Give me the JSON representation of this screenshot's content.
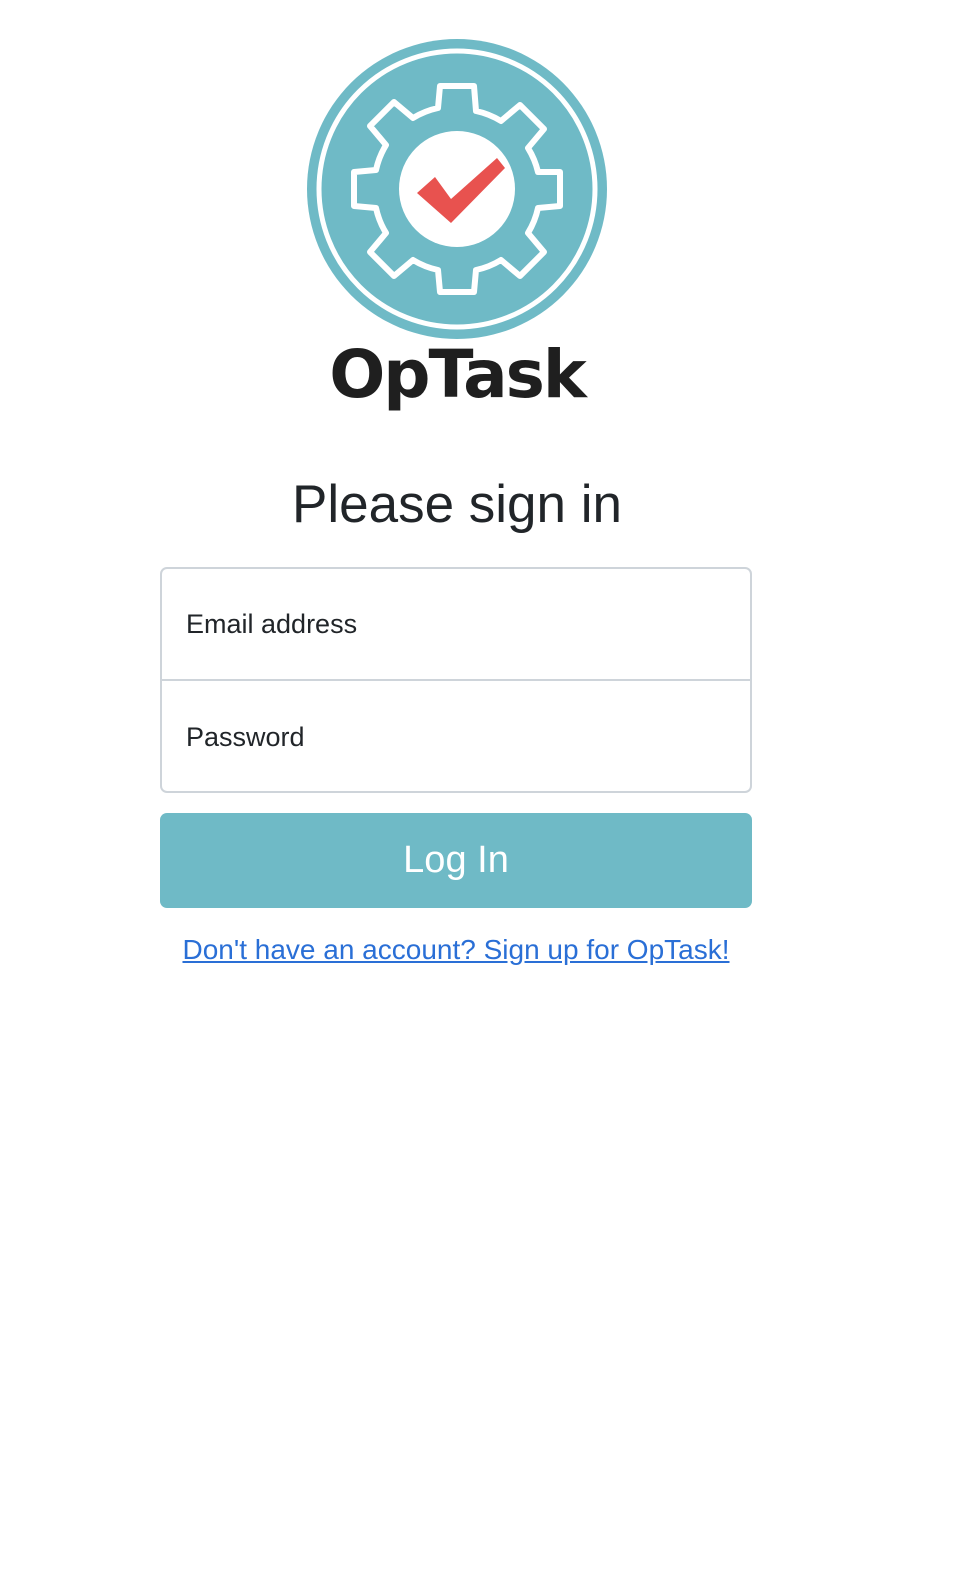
{
  "brand": {
    "name": "OpTask",
    "logo_icon": "gear-checkmark-icon",
    "colors": {
      "primary": "#6fbac6",
      "check": "#e8524f"
    }
  },
  "form": {
    "heading": "Please sign in",
    "email_placeholder": "Email address",
    "email_value": "",
    "password_placeholder": "Password",
    "password_value": "",
    "submit_label": "Log In"
  },
  "signup": {
    "link_text": "Don't have an account? Sign up for OpTask!",
    "link_color": "#2a6fd6"
  }
}
